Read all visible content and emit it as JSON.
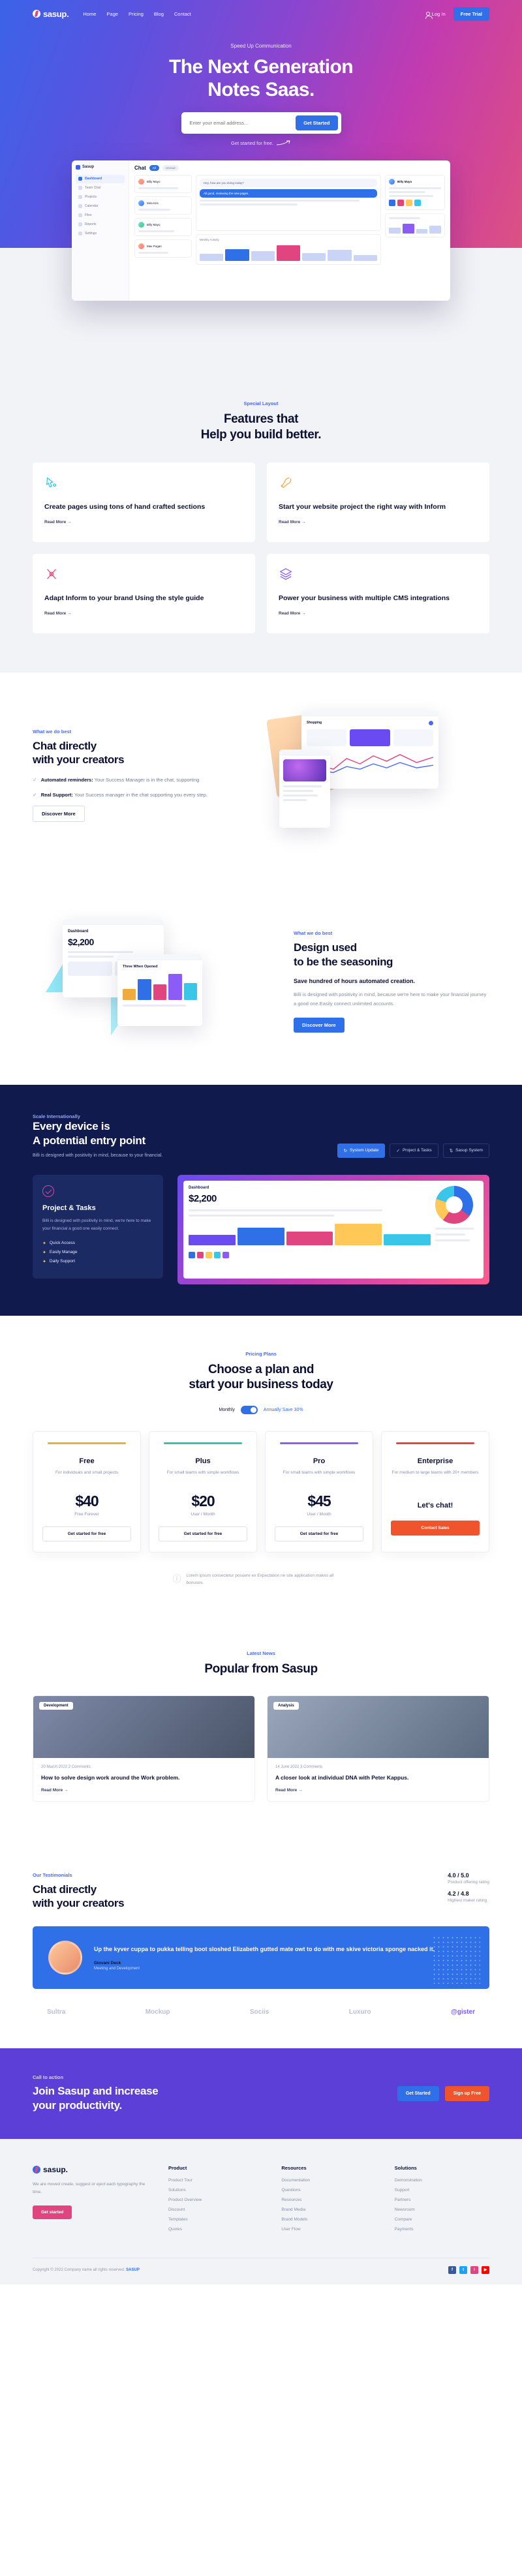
{
  "brand": {
    "name": "sasup.",
    "logo_icon": "sasup-logo-icon"
  },
  "nav": {
    "links": [
      "Home",
      "Page",
      "Pricing",
      "Blog",
      "Contact"
    ],
    "login_label": "Log In",
    "trial_label": "Free Trial"
  },
  "hero": {
    "eyebrow": "Speed Up Communication",
    "title_line1": "The Next Generation",
    "title_line2": "Notes Saas.",
    "email_placeholder": "Enter your email address...",
    "cta_label": "Get Started",
    "note": "Get started for free."
  },
  "hero_shot": {
    "app_name": "Sasup",
    "sidebar": [
      "Dashboard",
      "Team Chat",
      "Projects",
      "Calendar",
      "Files",
      "Reports",
      "Settings"
    ],
    "panel_title": "Chat",
    "pill_active": "All",
    "pill_muted": "Unread",
    "contacts": [
      "Billy Mayo",
      "Mira Kris",
      "Billy Mayo",
      "Max Pogan"
    ],
    "messages": [
      "Hey, how are you doing today?",
      "All good, reviewing the new pages."
    ],
    "chart_label": "Weekly Activity",
    "right_panel": "Billy Mayo"
  },
  "features": {
    "eyebrow": "Special Layout",
    "title_line1": "Features that",
    "title_line2": "Help you build better.",
    "read_more": "Read More  →",
    "cards": [
      {
        "icon": "mouse-pointer-icon",
        "color": "#3ac6e8",
        "title": "Create pages using tons of hand crafted sections"
      },
      {
        "icon": "wand-icon",
        "color": "#f0ab3d",
        "title": "Start your website project the right way with Inform"
      },
      {
        "icon": "brush-icon",
        "color": "#ef4a7b",
        "title": "Adapt Inform to your brand Using the style guide"
      },
      {
        "icon": "layers-icon",
        "color": "#8b5cf6",
        "title": "Power your business with multiple CMS integrations"
      }
    ]
  },
  "chat_section": {
    "eyebrow": "What we do best",
    "title_line1": "Chat directly",
    "title_line2": "with your creators",
    "bullets": [
      {
        "bold": "Automated reminders:",
        "text": " Your Success Manager is in the chat, supporting"
      },
      {
        "bold": "Real Support:",
        "text": " Your Success manager in the chat supporting you every step."
      }
    ],
    "button": "Discover More"
  },
  "design_section": {
    "eyebrow": "What we do best",
    "title_line1": "Design used",
    "title_line2": "to be the seasoning",
    "subtitle": "Save hundred of hours automated creation.",
    "paragraph": "Billi is designed with positivity in mind, because we're here to make your financial journey a good one.Easily connect unlimited accounts.",
    "button": "Discover More",
    "dashboard": {
      "label": "Dashboard",
      "amount": "$2,200",
      "chart_title": "Three When Opened"
    }
  },
  "dark_section": {
    "eyebrow": "Scale Internationally",
    "title_line1": "Every device is",
    "title_line2": "A potential entry point",
    "paragraph": "Billi is designed with positivity in mind, because to your financial.",
    "chips": [
      {
        "label": "System Update",
        "icon": "refresh-icon",
        "active": true
      },
      {
        "label": "Project & Tasks",
        "icon": "check-icon",
        "active": false
      },
      {
        "label": "Sasup System",
        "icon": "sync-icon",
        "active": false
      }
    ],
    "card": {
      "icon": "check-circle-icon",
      "title": "Project & Tasks",
      "paragraph": "Billi is designed with positivity in mind, we're here to make your financial a good one easily connect.",
      "items": [
        "Quick Access",
        "Easily Manage",
        "Daily Support"
      ]
    },
    "shot": {
      "label": "Dashboard",
      "amount": "$2,200"
    }
  },
  "pricing": {
    "eyebrow": "Pricing Plans",
    "title_line1": "Choose a plan and",
    "title_line2": "start your business today",
    "toggle_left": "Monthly",
    "toggle_right": "Annually Save 30%",
    "note": "Lorem ipsum consectetur posuere ex Expectation ne site application makes all bonuses.",
    "plans": [
      {
        "bar": "#f0ab3d",
        "name": "Free",
        "desc": "For individuals and small projects",
        "price": "$40",
        "per": "Free Forever",
        "button": "Get started for free",
        "fill": false
      },
      {
        "bar": "#2ec4b6",
        "name": "Plus",
        "desc": "For small teams with simple workflows",
        "price": "$20",
        "per": "User / Month",
        "button": "Get started for free",
        "fill": false
      },
      {
        "bar": "#8b5cf6",
        "name": "Pro",
        "desc": "For small teams with simple workflows",
        "price": "$45",
        "per": "User / Month",
        "button": "Get started for free",
        "fill": false
      },
      {
        "bar": "#e8453c",
        "name": "Enterprise",
        "desc": "For medium to large teams with 20+ members",
        "price": "Let's chat!",
        "per": "",
        "button": "Contact Sales",
        "fill": true
      }
    ]
  },
  "blog": {
    "eyebrow": "Latest News",
    "title": "Popular from Sasup",
    "read_more": "Read More  →",
    "posts": [
      {
        "tag": "Development",
        "meta": "20 March 2022    2 Comments",
        "title": "How to solve design work around the Work problem."
      },
      {
        "tag": "Analysis",
        "meta": "14 June 2022    3 Comments",
        "title": "A closer look at individual DNA with Peter Kappus."
      }
    ]
  },
  "testimonial": {
    "eyebrow": "Our Testimonials",
    "title_line1": "Chat directly",
    "title_line2": "with your creators",
    "ratings": [
      {
        "score": "4.0 / 5.0",
        "label": "Product offering rating"
      },
      {
        "score": "4.2 / 4.8",
        "label": "Highest maker rating"
      }
    ],
    "quote": "Up the kyver cuppa to pukka telling boot sloshed Elizabeth gutted mate owt to do with me skive victoria sponge nacked it.",
    "author": "Giovani Deck",
    "role": "Meeting and Development",
    "brands": [
      "Sultra",
      "Mockup",
      "Sociis",
      "Luxuro",
      "@gister"
    ]
  },
  "cta": {
    "eyebrow": "Call to action",
    "title_line1": "Join Sasup and increase",
    "title_line2": "your productivity.",
    "button_primary": "Get Started",
    "button_secondary": "Sign up Free"
  },
  "footer": {
    "description": "We are moved create, suggest or eject each typography the time.",
    "button": "Get started",
    "columns": [
      {
        "heading": "Product",
        "items": [
          "Product Tour",
          "Solutions",
          "Product Overview",
          "Discount",
          "Templates",
          "Quotes"
        ]
      },
      {
        "heading": "Resources",
        "items": [
          "Documentation",
          "Questions",
          "Resources",
          "Brand Media",
          "Brand Models",
          "User Flow"
        ]
      },
      {
        "heading": "Solutions",
        "items": [
          "Demonstration",
          "Support",
          "Partners",
          "Newsroom",
          "Compare",
          "Payments"
        ]
      }
    ],
    "copyright": "Copyright © 2022 Company name all rights reserved.",
    "copyright_brand": "SASUP",
    "socials": [
      {
        "name": "facebook-icon",
        "glyph": "f",
        "color": "#3b5998"
      },
      {
        "name": "twitter-icon",
        "glyph": "t",
        "color": "#1da1f2"
      },
      {
        "name": "instagram-icon",
        "glyph": "i",
        "color": "#e0457f"
      },
      {
        "name": "youtube-icon",
        "glyph": "▶",
        "color": "#ff0000"
      }
    ]
  }
}
